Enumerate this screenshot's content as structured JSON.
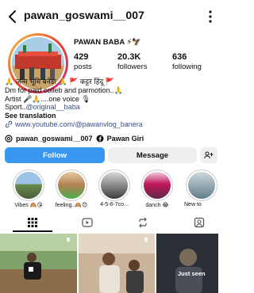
{
  "header": {
    "username": "pawan_goswami__007"
  },
  "profile": {
    "display_name": "PAWAN BABA ⚡🦅",
    "stats": [
      {
        "value": "429",
        "label": "posts"
      },
      {
        "value": "20.3K",
        "label": "followers"
      },
      {
        "value": "636",
        "label": "following"
      }
    ]
  },
  "bio": {
    "line1": "🙏 जन्म भूमि बनेड़ा 🙏          🚩 कट्टर हिंदू 🚩",
    "line2": "Dm for paid colleb and parmotion..🙏",
    "line3": "Artist 🎤🙏....one voice 🎙",
    "line4_prefix": "Sport..",
    "line4_tag": "@original__baba",
    "see_translation": "See translation",
    "link": "www.youtube.com/@pawanvlog_banera"
  },
  "handles": {
    "threads": "pawan_goswami__007",
    "facebook": "Pawan Giri"
  },
  "buttons": {
    "follow": "Follow",
    "message": "Message"
  },
  "highlights": [
    {
      "label": "Vibes 🙈😘"
    },
    {
      "label": "feeling..🙈😊"
    },
    {
      "label": "4-5-6-7co..."
    },
    {
      "label": "danch 😂"
    },
    {
      "label": "New to"
    }
  ],
  "grid": {
    "third_label": "Just seen"
  },
  "colors": {
    "accent": "#3897f0",
    "link": "#385185"
  }
}
